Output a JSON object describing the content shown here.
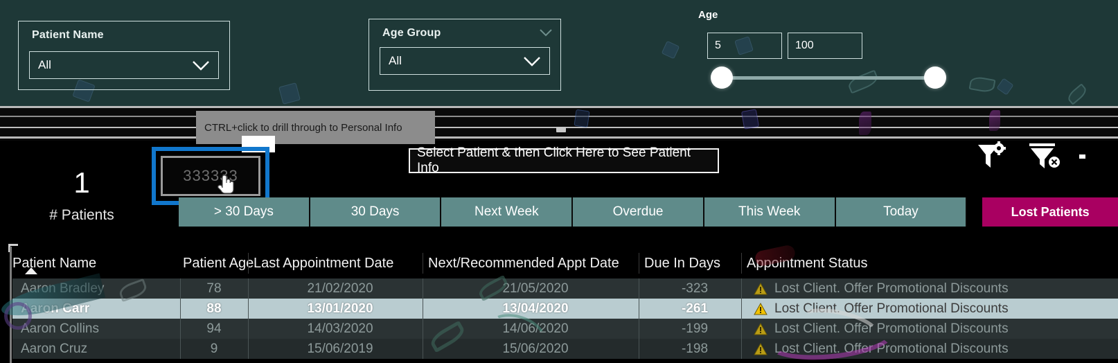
{
  "colors": {
    "teal_bg": "#1e3837",
    "accent_magenta": "#a90061",
    "button_teal": "#5f8b8a",
    "selection_blue": "#1177cc",
    "row_selected": "#b9ccd0",
    "warning_yellow": "#f2c200"
  },
  "filters": {
    "patient_name": {
      "title": "Patient Name",
      "value": "All",
      "chevron_icon": "chevron-down-icon"
    },
    "age_group": {
      "title": "Age Group",
      "value": "All",
      "collapse_icon": "chevron-down-icon",
      "chevron_icon": "chevron-down-icon"
    },
    "age": {
      "label": "Age",
      "min_value": "5",
      "max_value": "100",
      "slider_min_pos_pct": 0,
      "slider_max_pos_pct": 100
    }
  },
  "tooltips": {
    "drillthrough": "CTRL+click to drill through to Personal Info",
    "select_patient": "Select Patient & then Click Here to See Patient Info"
  },
  "kpi": {
    "value": "1",
    "label": "# Patients"
  },
  "drill_button": {
    "label": "333333",
    "cursor_icon": "hand-pointer-cursor",
    "selected": true
  },
  "nav_buttons": [
    {
      "label": "> 30 Days",
      "accent": false
    },
    {
      "label": "30 Days",
      "accent": false
    },
    {
      "label": "Next Week",
      "accent": false
    },
    {
      "label": "Overdue",
      "accent": false
    },
    {
      "label": "This Week",
      "accent": false
    },
    {
      "label": "Today",
      "accent": false
    },
    {
      "label": "Lost Patients",
      "accent": true
    }
  ],
  "filter_icons": [
    {
      "name": "filter-settings-icon",
      "title": "Filter settings"
    },
    {
      "name": "clear-filter-icon",
      "title": "Clear filter"
    }
  ],
  "table": {
    "sort_column": "Patient Name",
    "sort_direction": "ascending",
    "columns": [
      "Patient Name",
      "Patient Age",
      "Last Appointment Date",
      "Next/Recommended Appt Date",
      "Due In Days",
      "Appointment Status"
    ],
    "rows": [
      {
        "patient_name": "Aaron Bradley",
        "patient_age": "78",
        "last_appointment_date": "21/02/2020",
        "next_appt_date": "21/05/2020",
        "due_in_days": "-323",
        "status": "Lost Client. Offer Promotional Discounts",
        "status_icon": "warning-triangle-icon",
        "selected": false
      },
      {
        "patient_name": "Aaron Carr",
        "patient_age": "88",
        "last_appointment_date": "13/01/2020",
        "next_appt_date": "13/04/2020",
        "due_in_days": "-261",
        "status": "Lost Client. Offer Promotional Discounts",
        "status_icon": "warning-triangle-icon",
        "selected": true
      },
      {
        "patient_name": "Aaron Collins",
        "patient_age": "94",
        "last_appointment_date": "14/03/2020",
        "next_appt_date": "14/06/2020",
        "due_in_days": "-199",
        "status": "Lost Client. Offer Promotional Discounts",
        "status_icon": "warning-triangle-icon",
        "selected": false
      },
      {
        "patient_name": "Aaron Cruz",
        "patient_age": "9",
        "last_appointment_date": "15/06/2019",
        "next_appt_date": "15/06/2020",
        "due_in_days": "-198",
        "status": "Lost Client. Offer Promotional Discounts",
        "status_icon": "warning-triangle-icon",
        "selected": false
      }
    ]
  }
}
